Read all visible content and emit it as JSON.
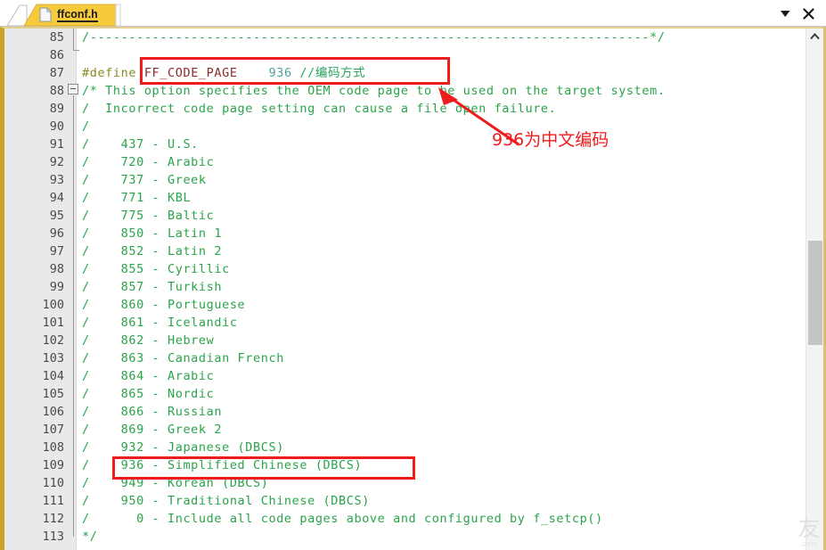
{
  "window": {
    "title": "ffconf.h",
    "chevron_icon": "chevron-down-icon",
    "close_icon": "close-icon"
  },
  "tab": {
    "label": "ffconf.h",
    "icon": "document-icon"
  },
  "scrollbar": {
    "up_icon": "scroll-up-arrow-icon"
  },
  "watermark": {
    "char": "友",
    "sub": ".com"
  },
  "annotations": {
    "note_text": "936为中文编码",
    "box_color": "#ee1c1c",
    "arrow_color": "#ee1c1c"
  },
  "colors": {
    "comment_green": "#2aa34a",
    "keyword_olive": "#8a8a1e",
    "macro_maroon": "#8b2b2b",
    "number_teal": "#4f9e9e",
    "tab_gold": "#f6c83f",
    "gutter_gray": "#e9e9e9",
    "frame_gold": "#c9a227"
  },
  "code": {
    "lines": [
      {
        "num": "85",
        "text": "/------------------------------------------------------------------------*/"
      },
      {
        "num": "86",
        "text": ""
      },
      {
        "num": "87",
        "html": "define_line"
      },
      {
        "num": "88",
        "text": "/* This option specifies the OEM code page to be used on the target system."
      },
      {
        "num": "89",
        "text": "/  Incorrect code page setting can cause a file open failure."
      },
      {
        "num": "90",
        "text": "/"
      },
      {
        "num": "91",
        "text": "/    437 - U.S."
      },
      {
        "num": "92",
        "text": "/    720 - Arabic"
      },
      {
        "num": "93",
        "text": "/    737 - Greek"
      },
      {
        "num": "94",
        "text": "/    771 - KBL"
      },
      {
        "num": "95",
        "text": "/    775 - Baltic"
      },
      {
        "num": "96",
        "text": "/    850 - Latin 1"
      },
      {
        "num": "97",
        "text": "/    852 - Latin 2"
      },
      {
        "num": "98",
        "text": "/    855 - Cyrillic"
      },
      {
        "num": "99",
        "text": "/    857 - Turkish"
      },
      {
        "num": "100",
        "text": "/    860 - Portuguese"
      },
      {
        "num": "101",
        "text": "/    861 - Icelandic"
      },
      {
        "num": "102",
        "text": "/    862 - Hebrew"
      },
      {
        "num": "103",
        "text": "/    863 - Canadian French"
      },
      {
        "num": "104",
        "text": "/    864 - Arabic"
      },
      {
        "num": "105",
        "text": "/    865 - Nordic"
      },
      {
        "num": "106",
        "text": "/    866 - Russian"
      },
      {
        "num": "107",
        "text": "/    869 - Greek 2"
      },
      {
        "num": "108",
        "text": "/    932 - Japanese (DBCS)"
      },
      {
        "num": "109",
        "text": "/    936 - Simplified Chinese (DBCS)"
      },
      {
        "num": "110",
        "text": "/    949 - Korean (DBCS)"
      },
      {
        "num": "111",
        "text": "/    950 - Traditional Chinese (DBCS)"
      },
      {
        "num": "112",
        "text": "/      0 - Include all code pages above and configured by f_setcp()"
      },
      {
        "num": "113",
        "text": "*/"
      }
    ],
    "define_line": {
      "keyword": "#define",
      "macro": "FF_CODE_PAGE",
      "spacer": "    ",
      "value": "936",
      "comment": " //编码方式"
    }
  }
}
